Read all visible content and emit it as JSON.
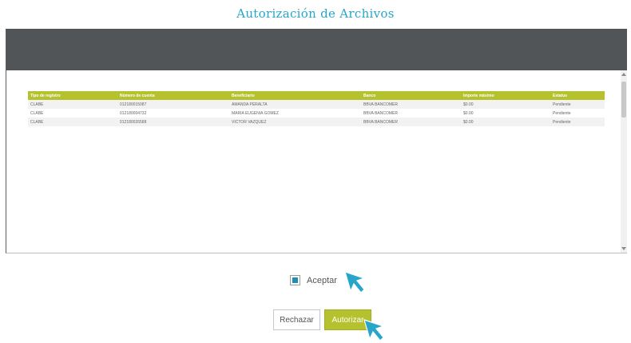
{
  "page": {
    "title": "Autorización de Archivos"
  },
  "table": {
    "headers": [
      "Tipo de registro",
      "Número de cuenta",
      "Beneficiario",
      "Banco",
      "Importe máximo",
      "Estatus"
    ],
    "rows": [
      [
        "CLABE",
        "012180015087",
        "AMANDA PERALTA",
        "BBVA BANCOMER",
        "$0.00",
        "Pendiente"
      ],
      [
        "CLABE",
        "012180004732",
        "MARIA EUGENIA GOMEZ",
        "BBVA BANCOMER",
        "$0.00",
        "Pendiente"
      ],
      [
        "CLABE",
        "012180026588",
        "VICTOR VAZQUEZ",
        "BBVA BANCOMER",
        "$0.00",
        "Pendiente"
      ]
    ]
  },
  "accept": {
    "label": "Aceptar",
    "checked": true
  },
  "buttons": {
    "reject_label": "Rechazar",
    "authorize_label": "Autorizar"
  },
  "colors": {
    "title": "#27a6c9",
    "header_bar": "#525557",
    "accent": "#b5c22e",
    "checkbox_fill": "#1f8fb0",
    "pointer": "#27a6c9"
  },
  "icons": {
    "pointer": "cursor-arrow-icon",
    "checkbox": "checkbox-checked-icon"
  }
}
